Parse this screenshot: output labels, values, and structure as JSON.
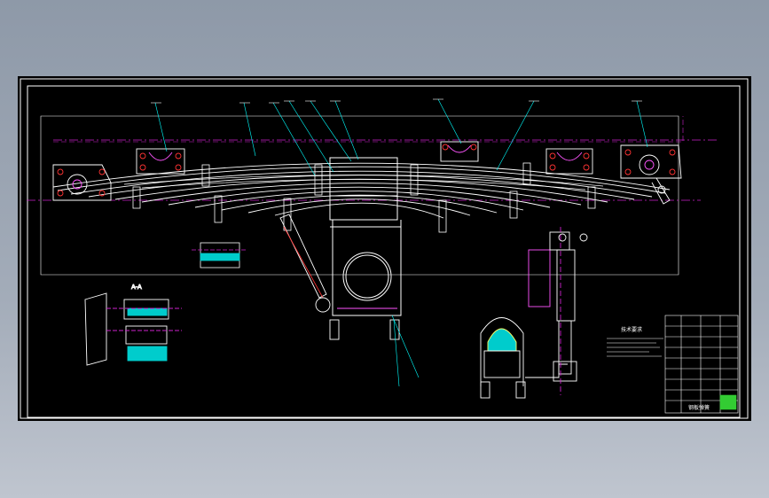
{
  "drawing": {
    "viewport_background": "#000000",
    "colors": {
      "frame": "#ffffff",
      "centerline": "#cc22cc",
      "outline": "#ffffff",
      "bracket": "#ff55ff",
      "annotation": "#00ffff",
      "bolt": "#ff3333",
      "fill_section": "#00cccc",
      "hatch": "#ffff66",
      "green_stamp": "#33cc33"
    },
    "technical_requirements_title": "技术要求",
    "title_block_stamp": "钢板弹簧",
    "detail_title": "A-A"
  }
}
